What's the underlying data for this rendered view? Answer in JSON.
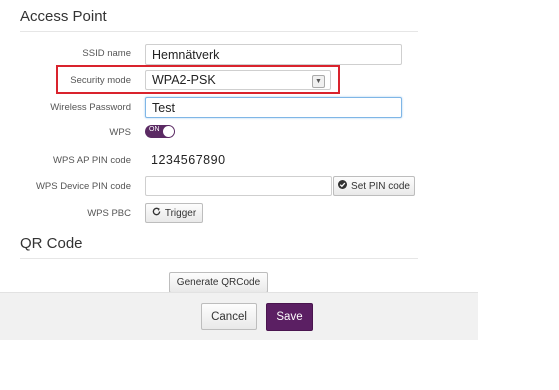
{
  "access_point": {
    "title": "Access Point",
    "ssid": {
      "label": "SSID name",
      "value": "Hemnätverk"
    },
    "security_mode": {
      "label": "Security mode",
      "value": "WPA2-PSK"
    },
    "wireless_password": {
      "label": "Wireless Password",
      "value": "Test"
    },
    "wps": {
      "label": "WPS",
      "toggle_label": "ON"
    },
    "wps_ap_pin": {
      "label": "WPS AP PIN code",
      "value": "1234567890"
    },
    "wps_device_pin": {
      "label": "WPS Device PIN code",
      "value": "",
      "button_label": "Set PIN code",
      "button_icon": "check-circle-icon"
    },
    "wps_pbc": {
      "label": "WPS PBC",
      "button_label": "Trigger",
      "button_icon": "refresh-icon"
    }
  },
  "qr_code": {
    "title": "QR Code",
    "generate_label": "Generate QRCode"
  },
  "footer": {
    "cancel_label": "Cancel",
    "save_label": "Save"
  },
  "colors": {
    "accent": "#5b1f63",
    "highlight": "#d9232d"
  }
}
